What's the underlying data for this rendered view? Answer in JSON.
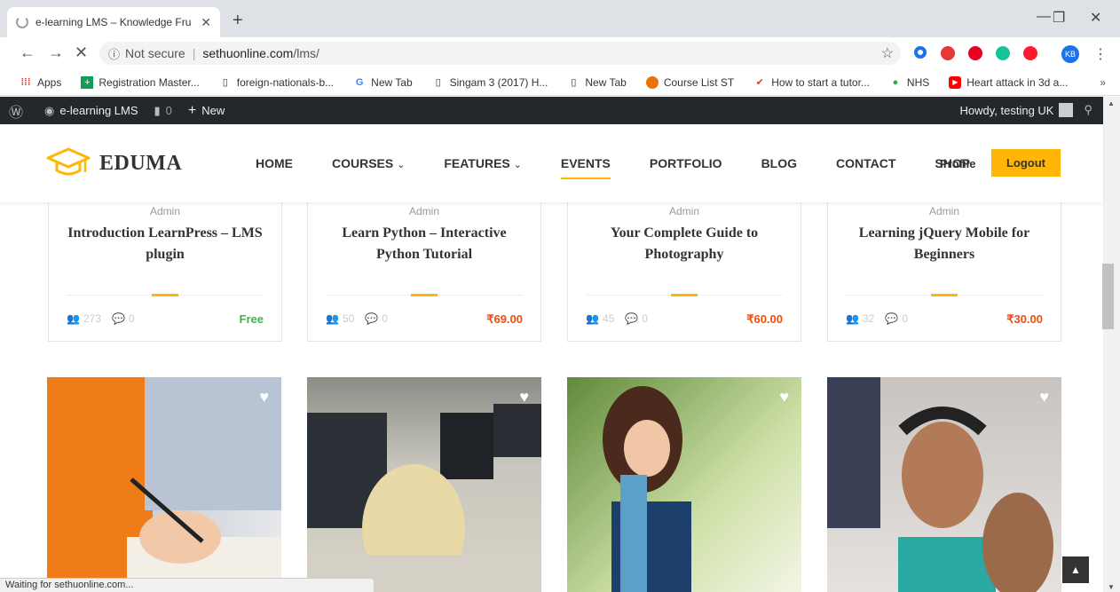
{
  "browser": {
    "tab_title": "e-learning LMS – Knowledge Fru",
    "omnibox": {
      "security": "Not secure",
      "host": "sethuonline.com",
      "path": "/lms/"
    },
    "profile_initials": "KB",
    "bookmarks": [
      {
        "label": "Apps",
        "icon": "apps-grid-icon"
      },
      {
        "label": "Registration Master...",
        "icon": "sheets-icon"
      },
      {
        "label": "foreign-nationals-b...",
        "icon": "page-icon"
      },
      {
        "label": "New Tab",
        "icon": "google-icon"
      },
      {
        "label": "Singam 3 (2017) H...",
        "icon": "page-icon"
      },
      {
        "label": "New Tab",
        "icon": "page-icon"
      },
      {
        "label": "Course List ST",
        "icon": "logo-icon"
      },
      {
        "label": "How to start a tutor...",
        "icon": "logo-icon"
      },
      {
        "label": "NHS",
        "icon": "logo-icon"
      },
      {
        "label": "Heart attack in 3d a...",
        "icon": "youtube-icon"
      }
    ],
    "status_text": "Waiting for sethuonline.com..."
  },
  "adminbar": {
    "site_name": "e-learning LMS",
    "comments_count": "0",
    "new_label": "New",
    "greeting": "Howdy, testing UK"
  },
  "header": {
    "logo_text": "EDUMA",
    "nav": [
      "HOME",
      "COURSES",
      "FEATURES",
      "EVENTS",
      "PORTFOLIO",
      "BLOG",
      "CONTACT",
      "SHOP"
    ],
    "profile_label": "Profile",
    "logout_label": "Logout"
  },
  "courses": [
    {
      "author": "Admin",
      "title": "Introduction LearnPress – LMS plugin",
      "students": "273",
      "comments": "0",
      "price": "Free",
      "price_color": "#3bb54a"
    },
    {
      "author": "Admin",
      "title": "Learn Python – Interactive Python Tutorial",
      "students": "50",
      "comments": "0",
      "price": "₹69.00",
      "price_color": "#f24c0a"
    },
    {
      "author": "Admin",
      "title": "Your Complete Guide to Photography",
      "students": "45",
      "comments": "0",
      "price": "₹60.00",
      "price_color": "#f24c0a"
    },
    {
      "author": "Admin",
      "title": "Learning jQuery Mobile for Beginners",
      "students": "32",
      "comments": "0",
      "price": "₹30.00",
      "price_color": "#f24c0a"
    }
  ],
  "colors": {
    "accent": "#ffb606",
    "adminbar": "#23282d"
  }
}
